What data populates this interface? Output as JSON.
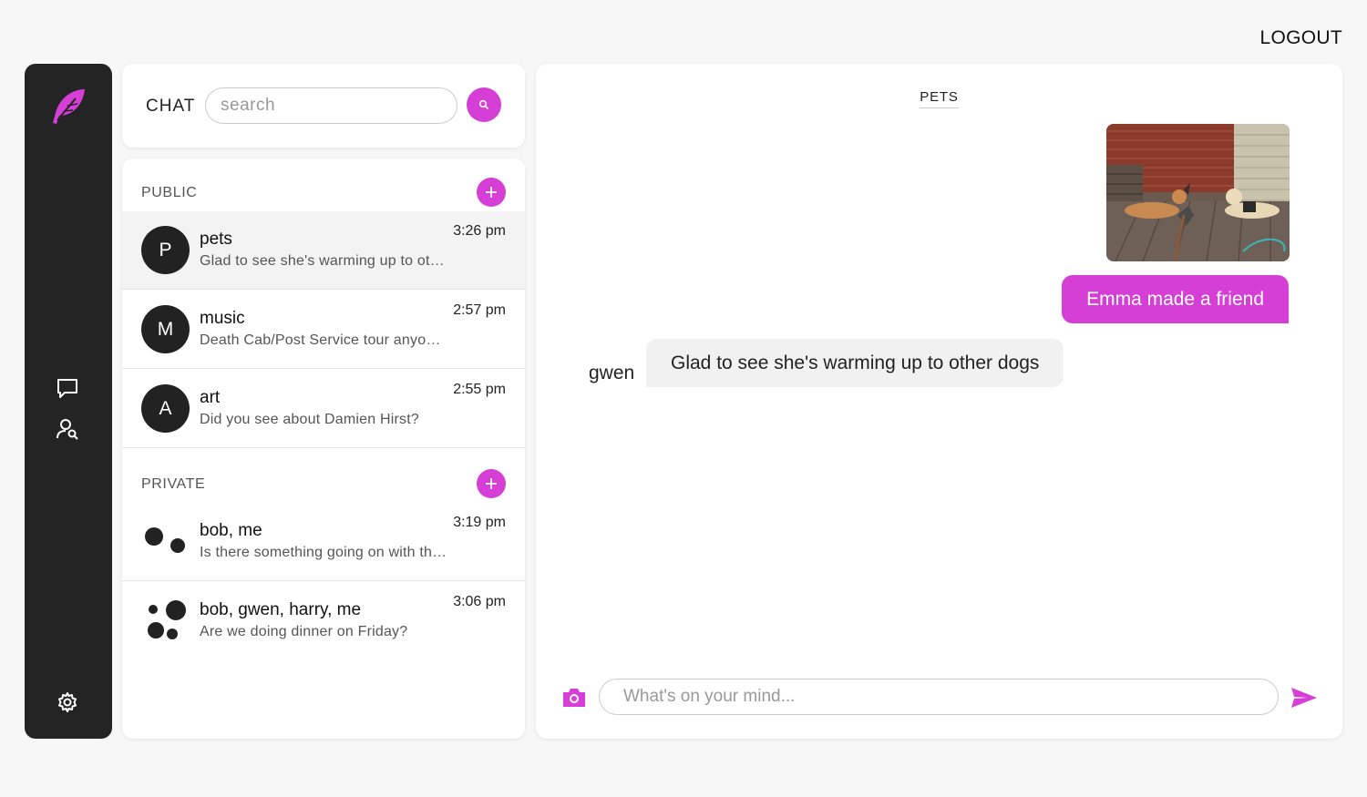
{
  "header": {
    "logout_label": "LOGOUT"
  },
  "rail": {
    "icons": [
      "feather-logo-icon",
      "chat-bubble-icon",
      "user-search-icon",
      "gear-icon"
    ]
  },
  "colors": {
    "accent": "#d63fd6",
    "rail_bg": "#242424"
  },
  "chat_search": {
    "label": "CHAT",
    "placeholder": "search"
  },
  "public": {
    "heading": "PUBLIC",
    "rooms": [
      {
        "initial": "P",
        "name": "pets",
        "preview": "Glad to see she's warming up to other dogs",
        "time": "3:26 pm",
        "active": true
      },
      {
        "initial": "M",
        "name": "music",
        "preview": "Death Cab/Post Service tour anyone?",
        "time": "2:57 pm",
        "active": false
      },
      {
        "initial": "A",
        "name": "art",
        "preview": "Did you see about Damien Hirst?",
        "time": "2:55 pm",
        "active": false
      }
    ]
  },
  "private": {
    "heading": "PRIVATE",
    "rooms": [
      {
        "name": "bob, me",
        "preview": "Is there something going on with the server?",
        "time": "3:19 pm"
      },
      {
        "name": "bob, gwen, harry, me",
        "preview": "Are we doing dinner on Friday?",
        "time": "3:06 pm"
      }
    ]
  },
  "conversation": {
    "title": "PETS",
    "messages": [
      {
        "type": "image",
        "from": "me"
      },
      {
        "type": "text",
        "from": "me",
        "text": "Emma made a friend"
      },
      {
        "type": "text",
        "from": "gwen",
        "sender_label": "gwen",
        "text": "Glad to see she's warming up to other dogs"
      }
    ]
  },
  "composer": {
    "placeholder": "What's on your mind..."
  }
}
